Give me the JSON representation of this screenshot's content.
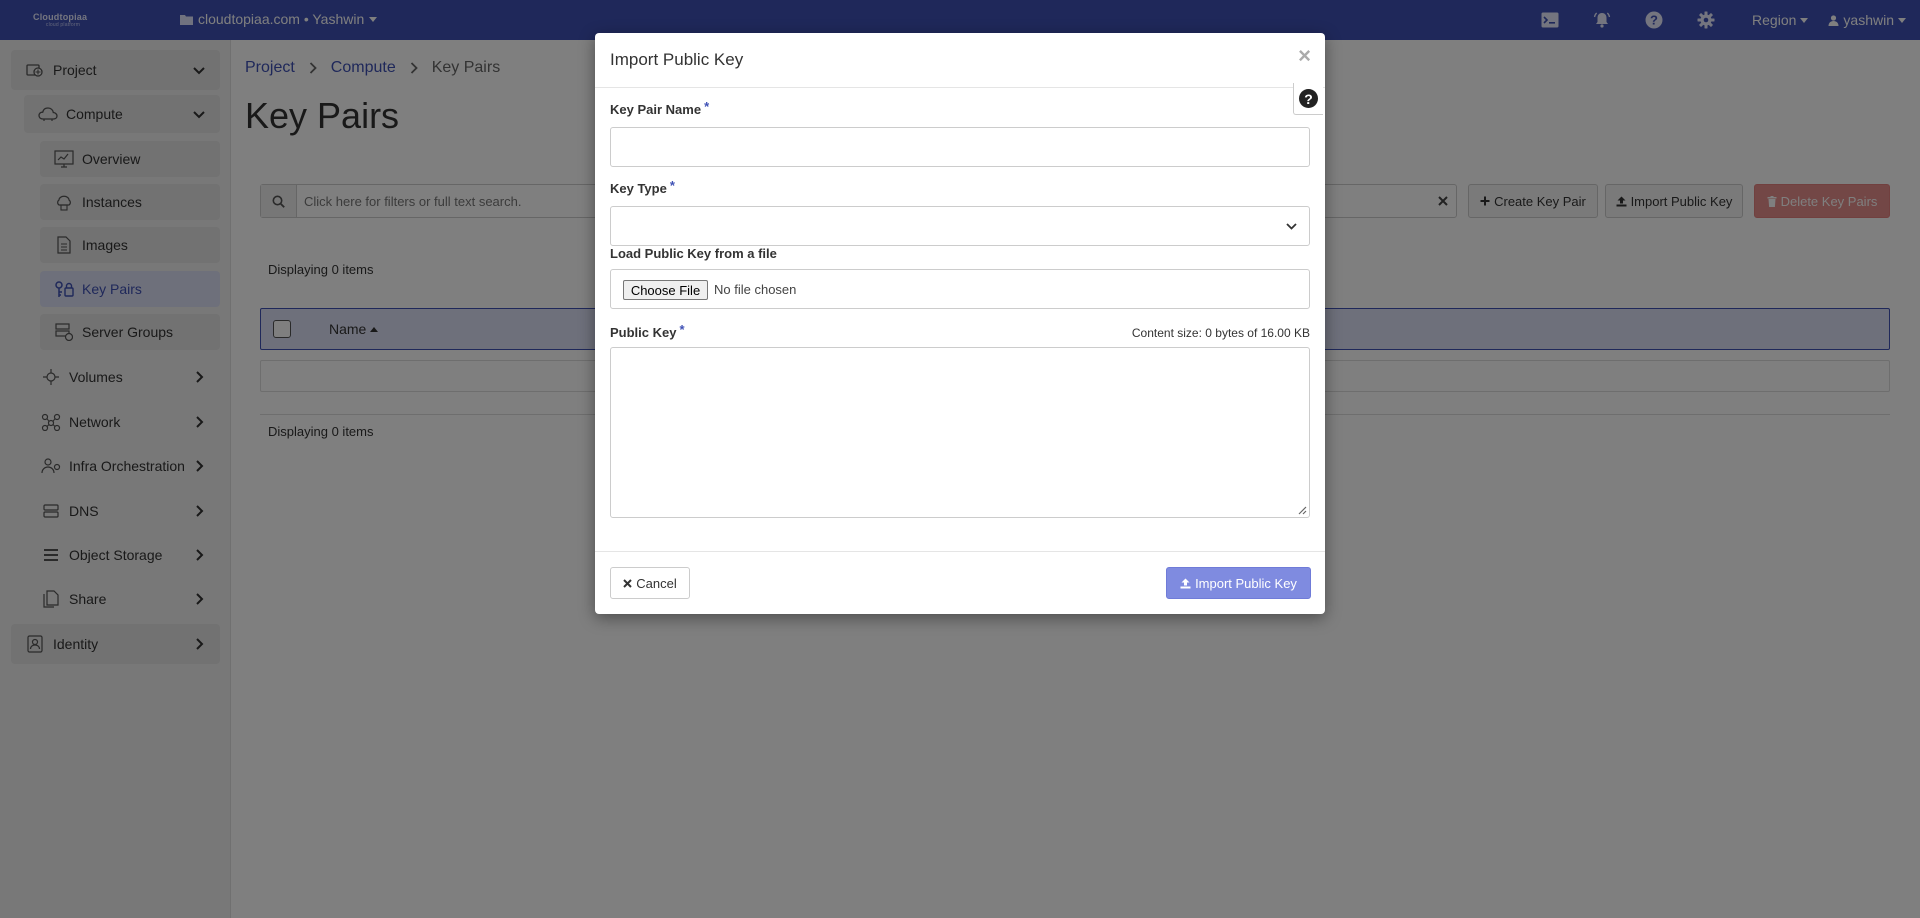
{
  "colors": {
    "primary": "#3f51b5",
    "danger": "#d9534f",
    "backdrop": "rgba(0,0,0,0.5)"
  },
  "topbar": {
    "brand": "Cloudtopiaa",
    "brand_tagline": "cloud platform",
    "project_selector": "cloudtopiaa.com • Yashwin",
    "icons": [
      "console-icon",
      "bell-icon",
      "help-icon",
      "gear-icon"
    ],
    "region_label": "Region",
    "user_label": "yashwin"
  },
  "sidebar": {
    "items": [
      {
        "label": "Project",
        "icon": "project-icon"
      },
      {
        "label": "Compute",
        "icon": "cloud-icon"
      },
      {
        "label": "Overview",
        "icon": "chart-icon"
      },
      {
        "label": "Instances",
        "icon": "instances-icon"
      },
      {
        "label": "Images",
        "icon": "document-icon"
      },
      {
        "label": "Key Pairs",
        "icon": "key-lock-icon"
      },
      {
        "label": "Server Groups",
        "icon": "server-icon"
      },
      {
        "label": "Volumes",
        "icon": "volume-icon"
      },
      {
        "label": "Network",
        "icon": "network-icon"
      },
      {
        "label": "Infra Orchestration",
        "icon": "orchestration-icon"
      },
      {
        "label": "DNS",
        "icon": "dns-icon"
      },
      {
        "label": "Object Storage",
        "icon": "storage-icon"
      },
      {
        "label": "Share",
        "icon": "share-icon"
      },
      {
        "label": "Identity",
        "icon": "identity-icon"
      }
    ]
  },
  "breadcrumb": {
    "items": [
      "Project",
      "Compute",
      "Key Pairs"
    ]
  },
  "page": {
    "title": "Key Pairs",
    "search_placeholder": "Click here for filters or full text search.",
    "create_label": "Create Key Pair",
    "import_label": "Import Public Key",
    "delete_label": "Delete Key Pairs",
    "count_top": "Displaying 0 items",
    "count_bottom": "Displaying 0 items",
    "columns": [
      "Name"
    ]
  },
  "modal": {
    "title": "Import Public Key",
    "close_glyph": "×",
    "help_glyph": "?",
    "key_pair_name_label": "Key Pair Name",
    "key_pair_name_value": "",
    "key_type_label": "Key Type",
    "key_type_value": "",
    "file_label": "Load Public Key from a file",
    "file_button": "Choose File",
    "file_status": "No file chosen",
    "public_key_label": "Public Key",
    "content_size": "Content size: 0 bytes of 16.00 KB",
    "public_key_value": "",
    "required_mark": "*",
    "cancel_label": "Cancel",
    "submit_label": "Import Public Key"
  }
}
